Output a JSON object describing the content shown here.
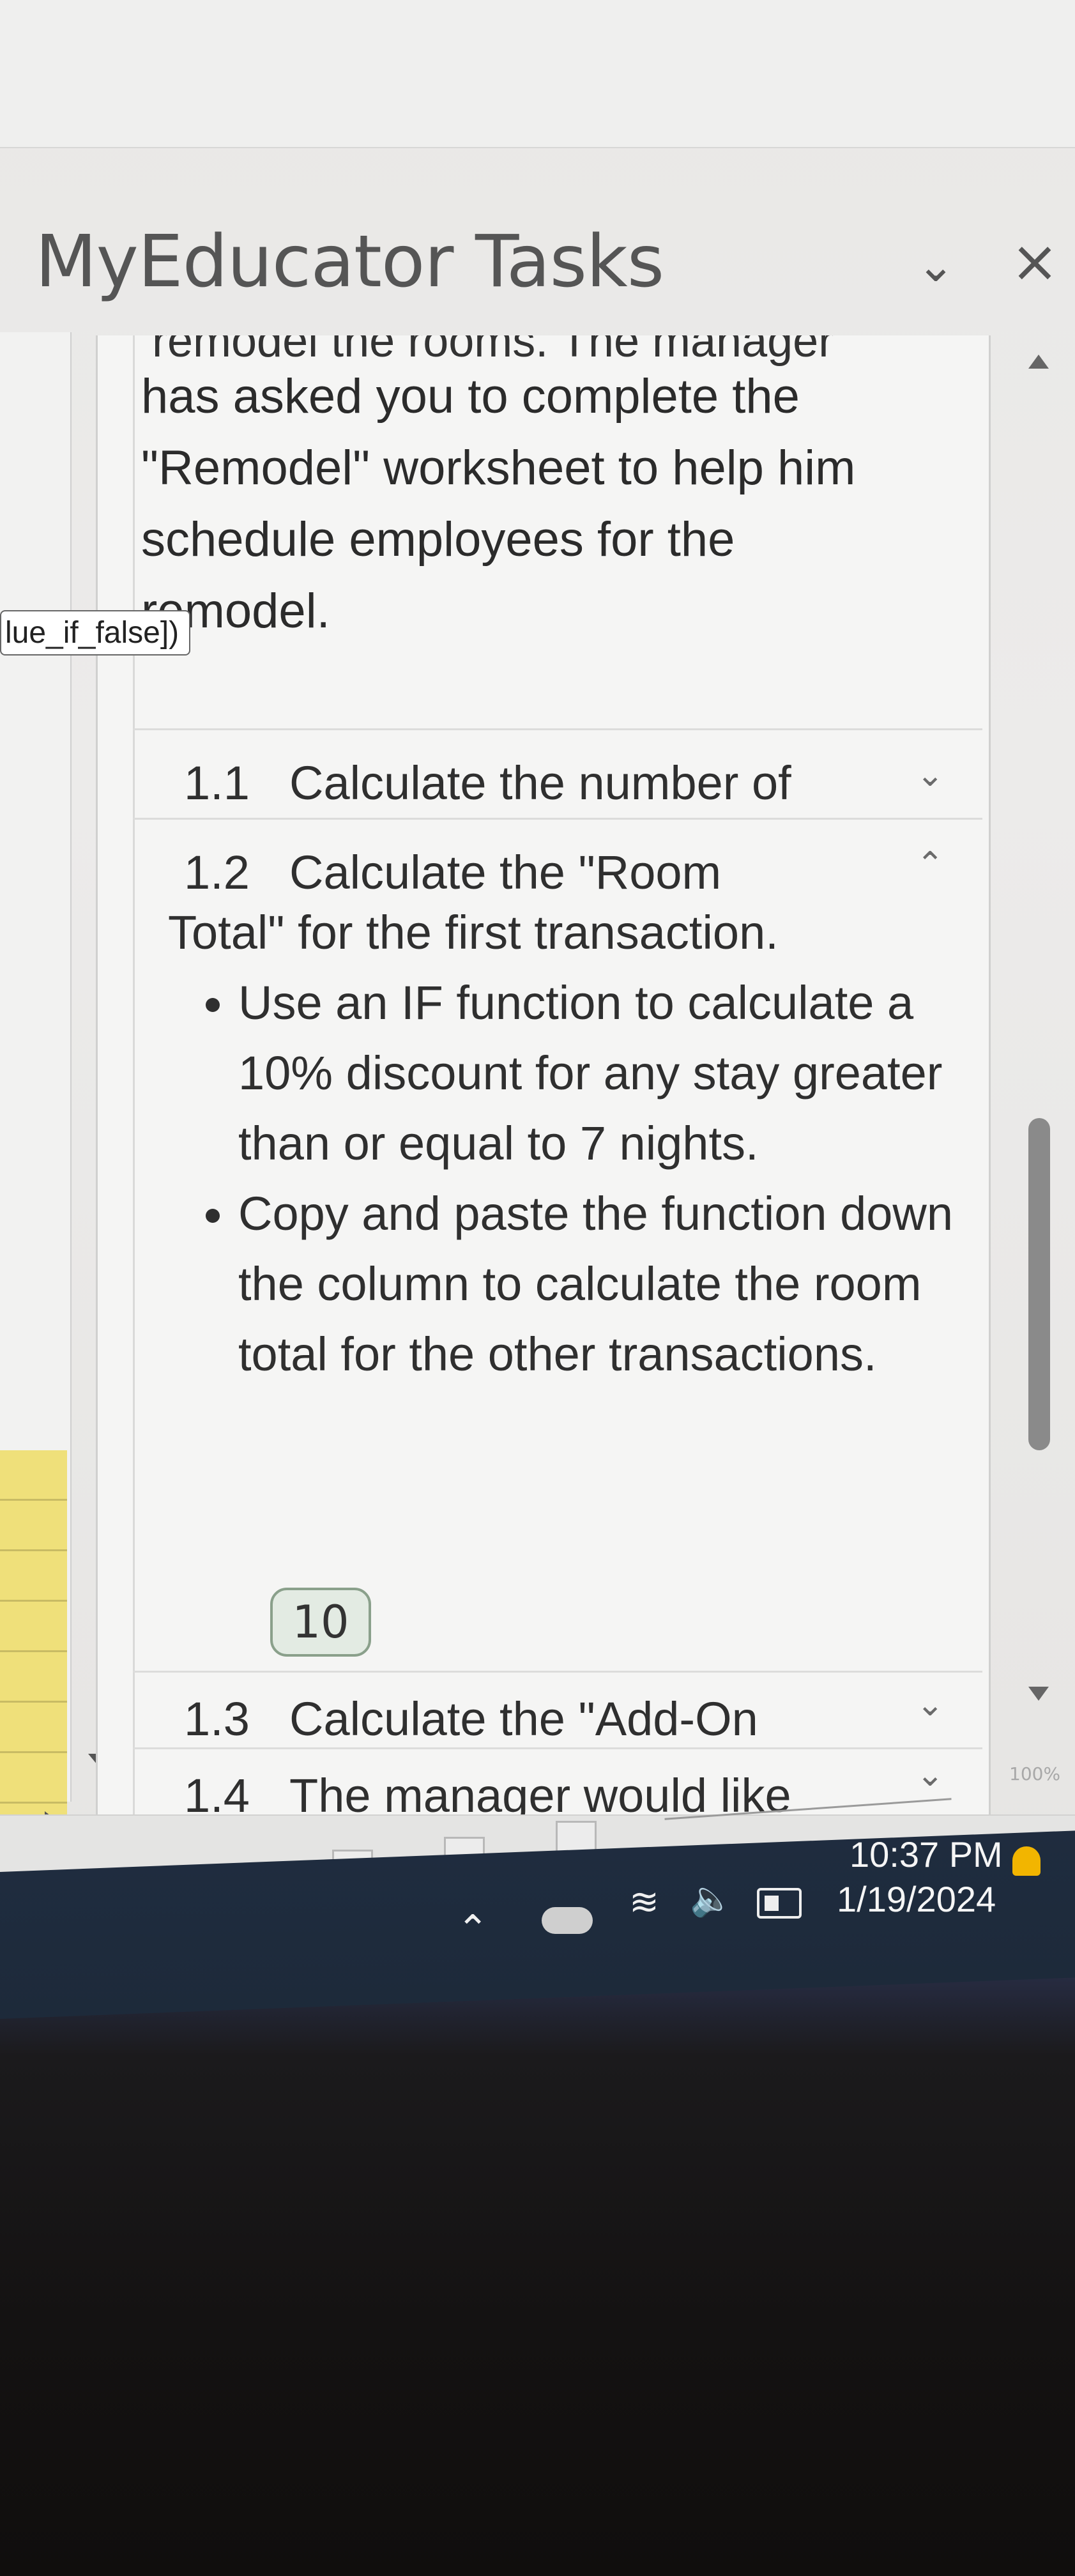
{
  "pane": {
    "title": "MyEducator Tasks",
    "collapse_icon": "chevron-down-icon",
    "close_icon": "close-icon"
  },
  "sheet": {
    "tooltip_text": "lue_if_false])"
  },
  "intro": {
    "cut_line": "remodel the rooms. The manager",
    "lines": [
      "has asked you to complete the",
      "\"Remodel\" worksheet to help him",
      "schedule employees for the",
      "remodel."
    ]
  },
  "tasks": [
    {
      "number": "1.1",
      "title": "Calculate the number of",
      "chevron": "chevron-down-icon"
    },
    {
      "number": "1.2",
      "title": "Calculate the \"Room",
      "chevron": "chevron-up-icon"
    },
    {
      "number": "1.3",
      "title": "Calculate the \"Add-On",
      "chevron": "chevron-down-icon"
    },
    {
      "number": "1.4",
      "title": "The manager would like",
      "chevron": "chevron-down-icon"
    }
  ],
  "task_1_2_detail": {
    "continuation": "Total\" for the first transaction.",
    "bullets": [
      "Use an IF function to calculate a 10% discount for any stay greater than or equal to 7 nights.",
      "Copy and paste the function down the column to calculate the room total for the other transactions."
    ],
    "points": "10"
  },
  "statusbar": {
    "zoom_label": "100%"
  },
  "taskbar": {
    "time": "10:37 PM",
    "date": "1/19/2024"
  }
}
